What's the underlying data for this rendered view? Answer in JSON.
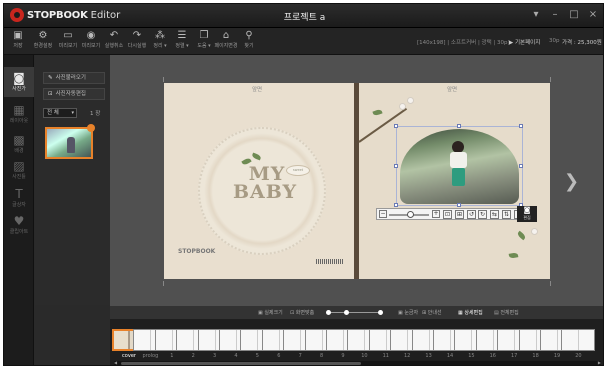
{
  "app": {
    "name": "STOPBOOK",
    "suffix": "Editor",
    "document_title": "프로젝트 a",
    "window_controls": [
      "▾",
      "–",
      "□",
      "×"
    ]
  },
  "toolbar": {
    "buttons": [
      {
        "label": "저장",
        "icon": "save-icon",
        "glyph": "▣"
      },
      {
        "label": "환경설정",
        "icon": "settings-icon",
        "glyph": "⚙"
      },
      {
        "label": "미리보기",
        "icon": "preview-icon",
        "glyph": "▭"
      },
      {
        "label": "미리보기",
        "icon": "eye-icon",
        "glyph": "◉"
      },
      {
        "label": "실행취소",
        "icon": "undo-icon",
        "glyph": "↶"
      },
      {
        "label": "다시실행",
        "icon": "redo-icon",
        "glyph": "↷"
      },
      {
        "label": "정리 ▾",
        "icon": "tidy-icon",
        "glyph": "⁂"
      },
      {
        "label": "정렬 ▾",
        "icon": "align-icon",
        "glyph": "☰"
      },
      {
        "label": "도움 ▾",
        "icon": "help-icon",
        "glyph": "❐"
      },
      {
        "label": "페이지변경",
        "icon": "bookmark-icon",
        "glyph": "⌂"
      },
      {
        "label": "찾기",
        "icon": "search-icon",
        "glyph": "⚲"
      }
    ],
    "info": {
      "size": "[140x198] | 소프트커버 | 광택 | 30p]",
      "base_page": "▶ 기본페이지",
      "pages_label": "30p",
      "price_label": "가격 : 25,300원"
    }
  },
  "leftrail": {
    "items": [
      {
        "label": "사진가",
        "icon": "camera-icon",
        "glyph": "◙",
        "active": true
      },
      {
        "label": "레이아웃",
        "icon": "layout-icon",
        "glyph": "▦",
        "active": false
      },
      {
        "label": "배경",
        "icon": "background-icon",
        "glyph": "▩",
        "active": false
      },
      {
        "label": "사진틀",
        "icon": "photo-frame-icon",
        "glyph": "▨",
        "active": false
      },
      {
        "label": "글상자",
        "icon": "text-icon",
        "glyph": "T",
        "active": false
      },
      {
        "label": "클립아트",
        "icon": "heart-icon",
        "glyph": "♥",
        "active": false
      }
    ]
  },
  "leftpanel": {
    "add_photo_label": "사진불러오기",
    "auto_edit_label": "사진자동편집",
    "filter_value": "전 체",
    "count_label": "1 장"
  },
  "canvas": {
    "left_page_tag": "앞면",
    "right_page_tag": "앞면",
    "title_line1": "MY",
    "title_line2": "BABY",
    "speech_text": "sweet",
    "publisher": "STOPBOOK"
  },
  "viewbar": {
    "items": [
      {
        "label": "▣ 실제크기",
        "active": false
      },
      {
        "label": "⊡ 화면맞춤",
        "active": false
      },
      {
        "label": "▣ 눈금자",
        "active": false
      },
      {
        "label": "⊞ 안내선",
        "active": false
      },
      {
        "label": "▦ 상세편집",
        "active": true
      },
      {
        "label": "▤ 전체편집",
        "active": false
      }
    ],
    "zoom_level": 0.35
  },
  "filmstrip": {
    "pages": [
      {
        "label": "cover",
        "active": true
      },
      {
        "label": "prolog",
        "active": false
      },
      {
        "label": "1",
        "active": false
      },
      {
        "label": "2",
        "active": false
      },
      {
        "label": "3",
        "active": false
      },
      {
        "label": "4",
        "active": false
      },
      {
        "label": "5",
        "active": false
      },
      {
        "label": "6",
        "active": false
      },
      {
        "label": "7",
        "active": false
      },
      {
        "label": "8",
        "active": false
      },
      {
        "label": "9",
        "active": false
      },
      {
        "label": "10",
        "active": false
      },
      {
        "label": "11",
        "active": false
      },
      {
        "label": "12",
        "active": false
      },
      {
        "label": "13",
        "active": false
      },
      {
        "label": "14",
        "active": false
      },
      {
        "label": "15",
        "active": false
      },
      {
        "label": "16",
        "active": false
      },
      {
        "label": "17",
        "active": false
      },
      {
        "label": "18",
        "active": false
      },
      {
        "label": "19",
        "active": false
      },
      {
        "label": "20",
        "active": false
      },
      {
        "label": "21",
        "active": false
      }
    ]
  },
  "colors": {
    "accent": "#e8822a",
    "brand": "#c8261e",
    "photo_frame_selection": "#6a7ab5"
  }
}
